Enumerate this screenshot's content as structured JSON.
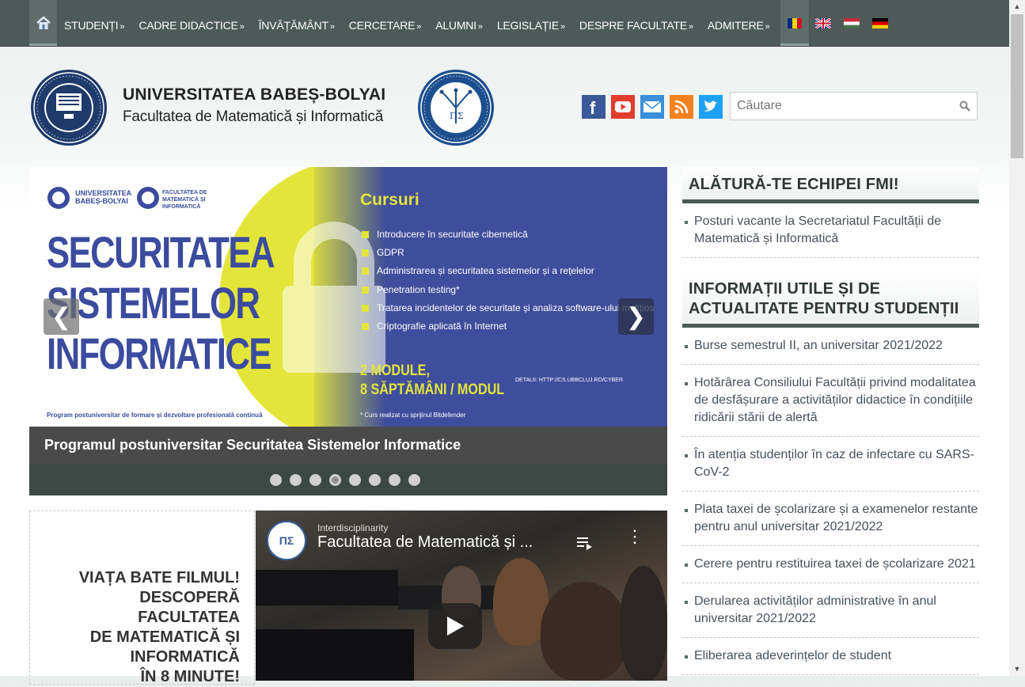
{
  "nav": {
    "home_icon": "home-icon",
    "items": [
      {
        "label": "STUDENȚI"
      },
      {
        "label": "CADRE DIDACTICE"
      },
      {
        "label": "ÎNVĂȚĂMÂNT"
      },
      {
        "label": "CERCETARE"
      },
      {
        "label": "ALUMNI"
      },
      {
        "label": "LEGISLAȚIE"
      },
      {
        "label": "DESPRE FACULTATE"
      },
      {
        "label": "ADMITERE"
      }
    ],
    "arrow": "»",
    "languages": [
      "ro-flag-icon",
      "uk-flag-icon",
      "hu-flag-icon",
      "de-flag-icon"
    ]
  },
  "header": {
    "university": "UNIVERSITATEA BABEȘ-BOLYAI",
    "faculty": "Facultatea de Matematică și Informatică",
    "social": [
      "facebook-icon",
      "youtube-icon",
      "email-icon",
      "rss-icon",
      "twitter-icon"
    ],
    "search_placeholder": "Căutare"
  },
  "slider": {
    "logo_left": "UNIVERSITATEA BABEȘ-BOLYAI",
    "logo_right": "FACULTATEA DE MATEMATICĂ ȘI INFORMATICĂ",
    "title_lines": [
      "SECURITATEA",
      "SISTEMELOR",
      "INFORMATICE"
    ],
    "cursuri": "Cursuri",
    "courses": [
      "Introducere în securitate cibernetică",
      "GDPR",
      "Administrarea și securitatea sistemelor și a rețelelor",
      "Penetration testing*",
      "Tratarea incidentelor de securitate și analiza software-ului malițios",
      "Criptografie aplicată în Internet"
    ],
    "modules_line1": "2 MODULE,",
    "modules_line2": "8 SĂPTĂMÂNI / MODUL",
    "details": "DETALII: HTTP://CS.UBBCLUJ.RO/CYBER",
    "foot_left": "Program postuniversitar de formare și dezvoltare profesională continuă",
    "foot_right": "* Curs realizat cu sprijinul Bitdefender",
    "caption": "Programul postuniversitar Securitatea Sistemelor Informatice",
    "dot_count": 8,
    "active_dot": 4,
    "prev": "❮",
    "next": "❯"
  },
  "promo": {
    "lines": [
      "VIAȚA BATE FILMUL!",
      "DESCOPERĂ",
      "FACULTATEA",
      "DE MATEMATICĂ ȘI",
      "INFORMATICĂ",
      "ÎN 8 MINUTE!"
    ]
  },
  "video": {
    "overlay_top": "Interdisciplinarity",
    "title": "Facultatea de Matematică și ...",
    "logo_text": "ΠΣ"
  },
  "sidebar": {
    "section1_title": "ALĂTURĂ-TE ECHIPEI FMI!",
    "section1_items": [
      "Posturi vacante la Secretariatul Facultății de Matematică și Informatică"
    ],
    "section2_title": "INFORMAȚII UTILE ȘI DE ACTUALITATE PENTRU STUDENȚII",
    "section2_items": [
      "Burse semestrul II, an universitar 2021/2022",
      "Hotărârea Consiliului Facultății privind modalitatea de desfășurare a activităților didactice în condițiile ridicării stării de alertă",
      "În atenția studenților în caz de infectare cu SARS-CoV-2",
      "Plata taxei de școlarizare și a examenelor restante pentru anul universitar 2021/2022",
      "Cerere pentru restituirea taxei de școlarizare 2021",
      "Derularea activităților administrative în anul universitar 2021/2022",
      "Eliberarea adeverințelor de student"
    ]
  },
  "colors": {
    "nav_bg": "#4d5a57",
    "slider_blue": "#3f4e9c",
    "slider_yellow": "#e4e53a"
  }
}
